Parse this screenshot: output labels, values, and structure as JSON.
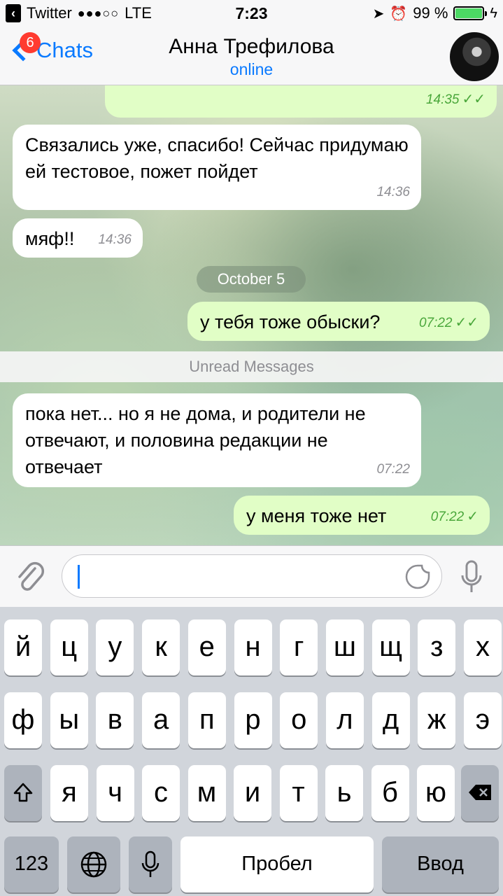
{
  "status_bar": {
    "app_back": "Twitter",
    "signal": "●●●○○",
    "network": "LTE",
    "time": "7:23",
    "battery_percent": "99 %",
    "battery_level": 0.99
  },
  "nav": {
    "back_label": "Chats",
    "unread_badge": "6",
    "title": "Анна Трефилова",
    "subtitle": "online"
  },
  "messages": [
    {
      "direction": "out",
      "text": "",
      "time": "14:35",
      "status": "read"
    },
    {
      "direction": "in",
      "text": "Связались уже, спасибо! Сейчас придумаю ей тестовое, пожет пойдет",
      "time": "14:36"
    },
    {
      "direction": "in",
      "text": "мяф!!",
      "time": "14:36"
    },
    {
      "direction": "out",
      "text": "у тебя тоже обыски?",
      "time": "07:22",
      "status": "read"
    },
    {
      "direction": "in",
      "text": "пока нет... но я не дома, и родители не отвечают, и половина редакции не отвечает",
      "time": "07:22"
    },
    {
      "direction": "out",
      "text": "у меня тоже нет",
      "time": "07:22",
      "status": "delivered"
    }
  ],
  "date_separator": "October 5",
  "unread_separator": "Unread Messages",
  "input": {
    "value": "",
    "placeholder": ""
  },
  "keyboard": {
    "row1": [
      "й",
      "ц",
      "у",
      "к",
      "е",
      "н",
      "г",
      "ш",
      "щ",
      "з",
      "х"
    ],
    "row2": [
      "ф",
      "ы",
      "в",
      "а",
      "п",
      "р",
      "о",
      "л",
      "д",
      "ж",
      "э"
    ],
    "row3": [
      "я",
      "ч",
      "с",
      "м",
      "и",
      "т",
      "ь",
      "б",
      "ю"
    ],
    "numbers_label": "123",
    "space_label": "Пробел",
    "return_label": "Ввод"
  },
  "colors": {
    "accent": "#0a7aff",
    "badge": "#ff3b30",
    "outgoing_bubble": "#e1fec6",
    "read_check": "#4aa73b",
    "battery": "#4cd964"
  }
}
